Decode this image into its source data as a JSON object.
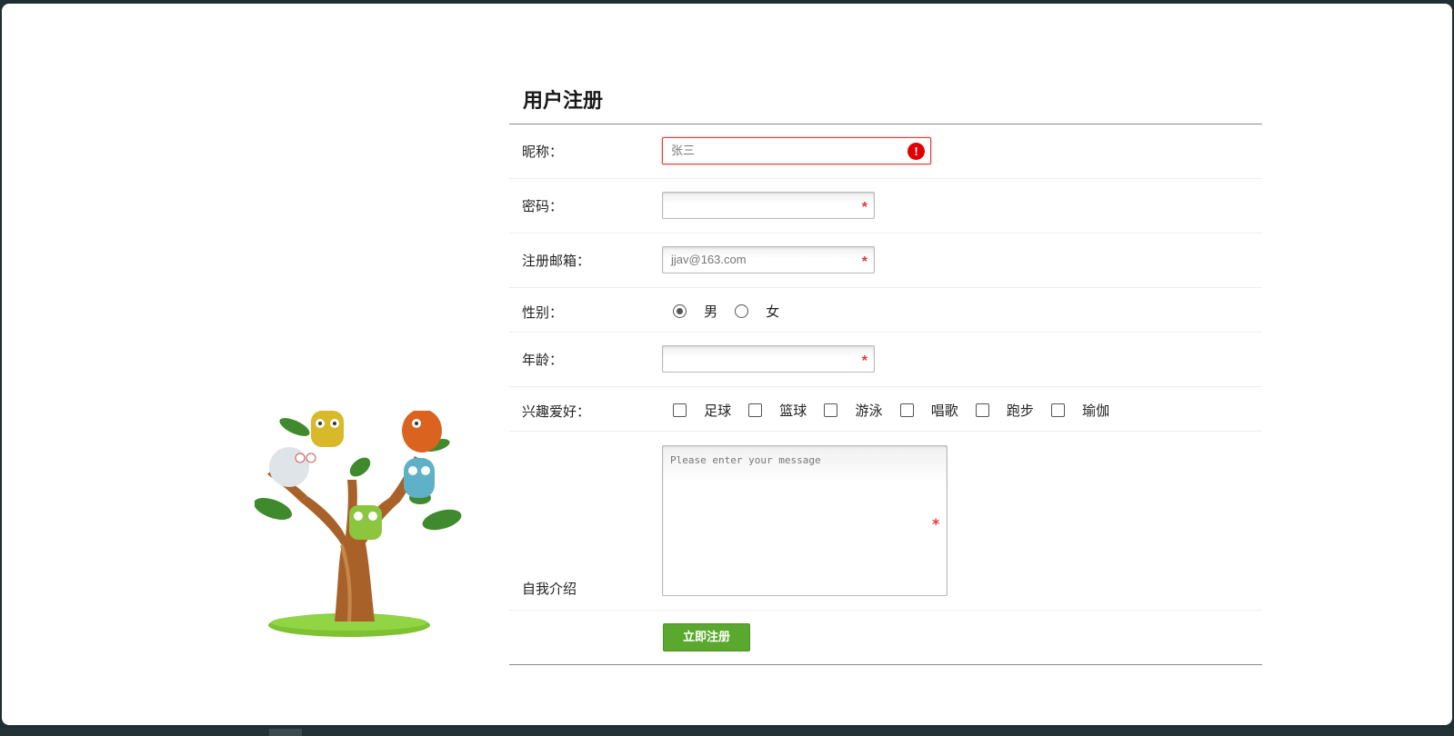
{
  "form": {
    "title": "用户注册",
    "nickname": {
      "label": "昵称：",
      "value": "张三",
      "error_icon": "!"
    },
    "password": {
      "label": "密码：",
      "value": "",
      "required_mark": "*"
    },
    "email": {
      "label": "注册邮箱：",
      "value": "jjav@163.com",
      "required_mark": "*"
    },
    "gender": {
      "label": "性别：",
      "options": [
        "男",
        "女"
      ],
      "selected": "男"
    },
    "age": {
      "label": "年龄：",
      "value": "",
      "required_mark": "*"
    },
    "hobbies": {
      "label": "兴趣爱好：",
      "options": [
        "足球",
        "篮球",
        "游泳",
        "唱歌",
        "跑步",
        "瑜伽"
      ]
    },
    "intro": {
      "label": "自我介绍",
      "placeholder": "Please enter your message",
      "required_mark": "*"
    },
    "submit_label": "立即注册"
  },
  "colors": {
    "accent_green": "#5aa82e",
    "error_red": "#e00000",
    "required_red": "#e23b3b"
  },
  "icons": [
    "error-icon",
    "owl-tree-illustration"
  ]
}
